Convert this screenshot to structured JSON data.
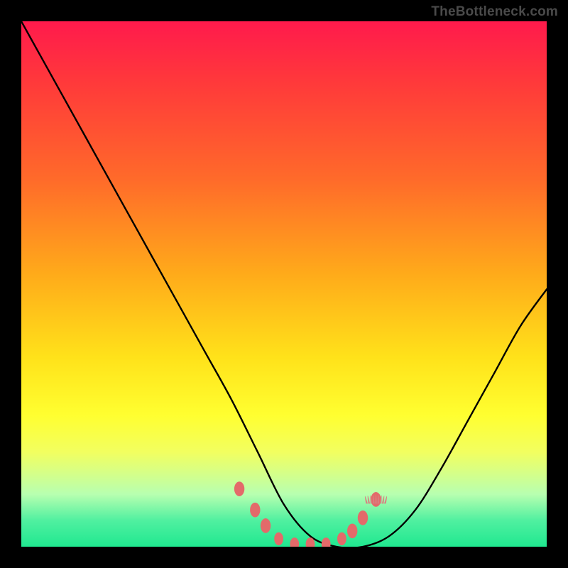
{
  "watermark": "TheBottleneck.com",
  "colors": {
    "frame": "#000000",
    "gradient_top": "#ff1a4c",
    "gradient_bottom": "#20e890",
    "curve": "#000000",
    "marker": "#e36a6a"
  },
  "chart_data": {
    "type": "line",
    "title": "",
    "xlabel": "",
    "ylabel": "",
    "xlim": [
      0,
      100
    ],
    "ylim": [
      0,
      100
    ],
    "x": [
      0,
      5,
      10,
      15,
      20,
      25,
      30,
      35,
      40,
      45,
      50,
      55,
      60,
      65,
      70,
      75,
      80,
      85,
      90,
      95,
      100
    ],
    "values": [
      100,
      91,
      82,
      73,
      64,
      55,
      46,
      37,
      28,
      18,
      8,
      2,
      0,
      0,
      2,
      7,
      15,
      24,
      33,
      42,
      49
    ],
    "optimum_x_range": [
      48,
      62
    ],
    "marker_x": [
      41.5,
      44.5,
      46.5,
      49,
      52,
      55,
      58,
      61,
      63,
      65,
      67.5
    ],
    "marker_y": [
      11,
      7,
      4,
      1.5,
      0.5,
      0.5,
      0.5,
      1.5,
      3,
      5.5,
      9
    ],
    "marker_radius": [
      4.5,
      4.5,
      4.5,
      4,
      4,
      4,
      4,
      4,
      4.5,
      4.5,
      4.5
    ],
    "grass_cluster_x": 67.5
  }
}
